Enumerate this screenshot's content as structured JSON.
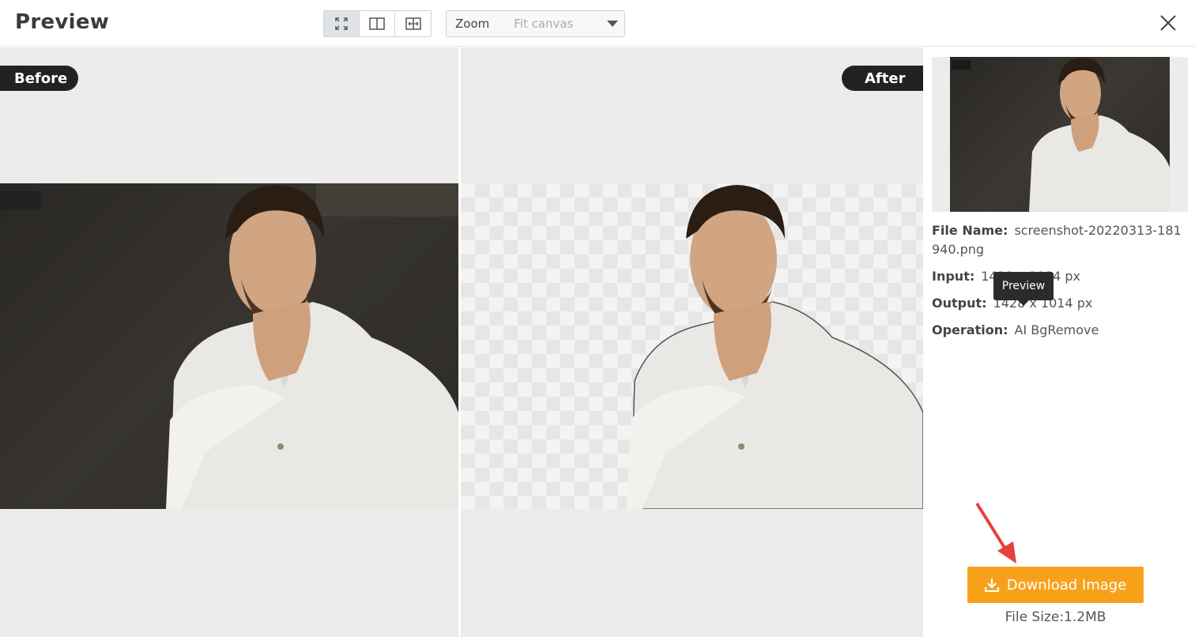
{
  "header": {
    "title": "Preview",
    "view_modes": [
      {
        "name": "fullscreen",
        "icon": "expand-icon",
        "active": true
      },
      {
        "name": "side-by-side",
        "icon": "split-view-icon",
        "active": false
      },
      {
        "name": "slider-compare",
        "icon": "compare-slider-icon",
        "active": false
      }
    ],
    "zoom": {
      "label": "Zoom",
      "value": "Fit canvas"
    },
    "close_icon": "close-icon"
  },
  "panes": {
    "before_label": "Before",
    "after_label": "After"
  },
  "details": {
    "file_name_label": "File Name:",
    "file_name": "screenshot-20220313-181940.png",
    "input_label": "Input:",
    "input_value": "1428 x 1014 px",
    "output_label": "Output:",
    "output_value": "1428 x 1014 px",
    "operation_label": "Operation:",
    "operation_value": "AI BgRemove",
    "tooltip": "Preview"
  },
  "download": {
    "label": "Download Image",
    "icon": "download-icon",
    "file_size": "File Size:1.2MB"
  },
  "colors": {
    "accent": "#f7a11a",
    "badge": "#222222",
    "annotation_arrow": "#e8403a"
  }
}
